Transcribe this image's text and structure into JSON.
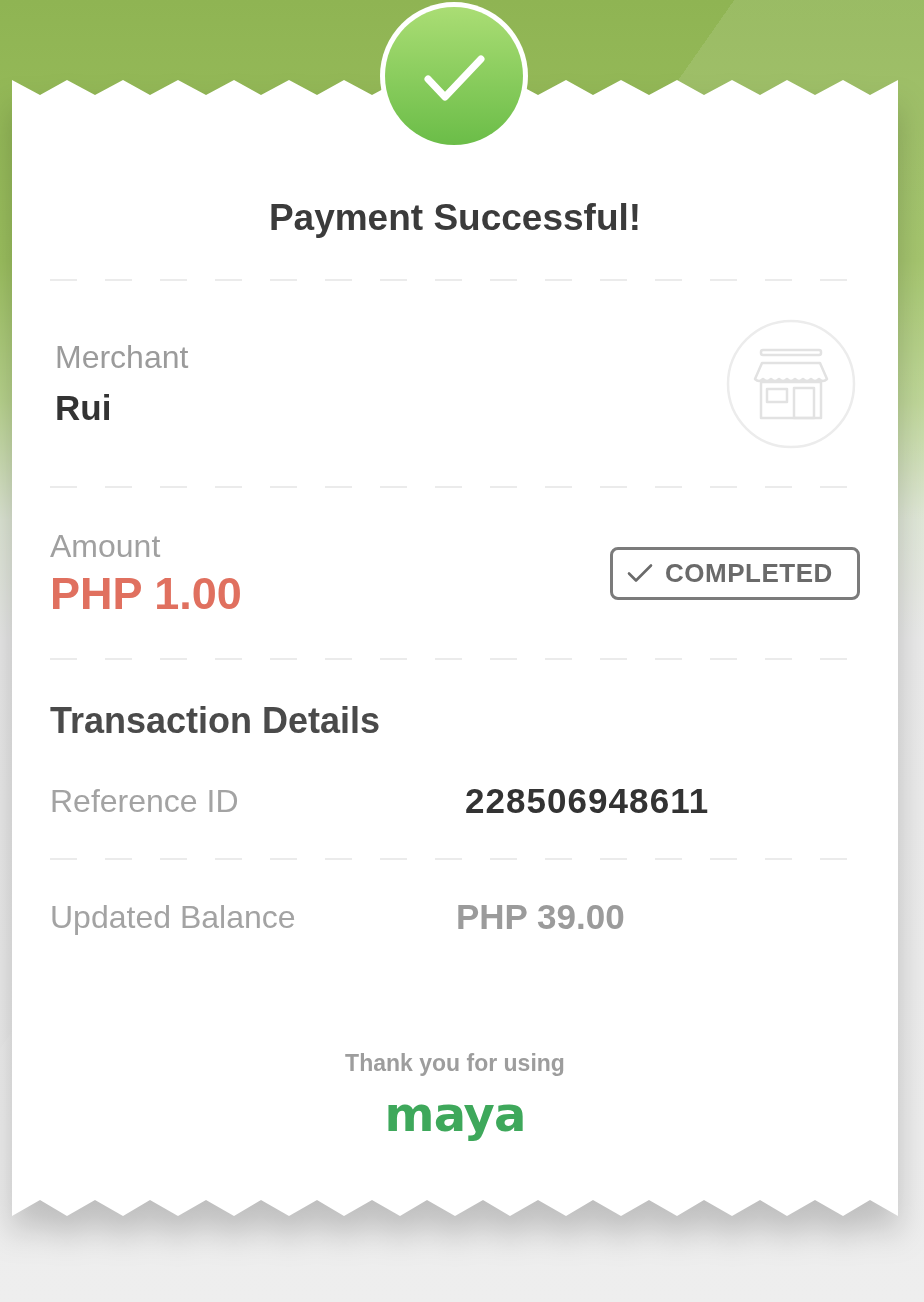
{
  "title": "Payment Successful!",
  "merchant": {
    "label": "Merchant",
    "name": "Rui"
  },
  "amount": {
    "label": "Amount",
    "value": "PHP 1.00",
    "status": "COMPLETED"
  },
  "transaction_details": {
    "heading": "Transaction Details",
    "rows": [
      {
        "kind": "emphasized",
        "label": "Reference ID",
        "value": "228506948611"
      },
      {
        "kind": "muted",
        "label": "Updated Balance",
        "value": "PHP 39.00"
      }
    ]
  },
  "footer": {
    "text": "Thank you for using",
    "brand": "maya"
  }
}
